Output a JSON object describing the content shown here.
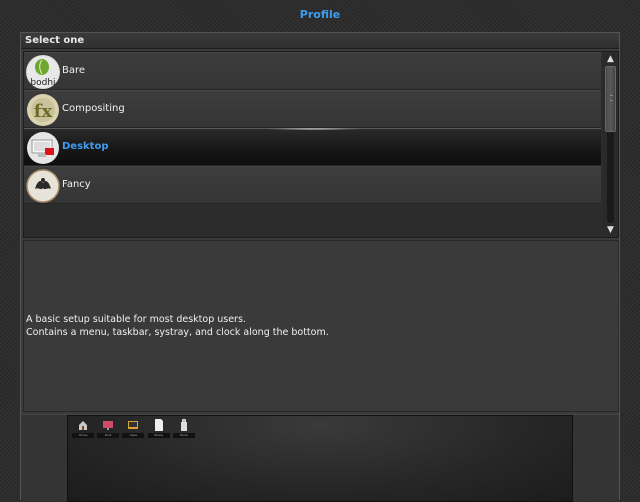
{
  "window": {
    "title": "Profile"
  },
  "section": {
    "header": "Select one"
  },
  "profiles": [
    {
      "label": "Bare",
      "icon": "bodhi-leaf-icon",
      "icon_text": "bodhi",
      "selected": false
    },
    {
      "label": "Compositing",
      "icon": "compositing-fx-icon",
      "icon_text": "fx",
      "selected": false
    },
    {
      "label": "Desktop",
      "icon": "desktop-icon",
      "selected": true
    },
    {
      "label": "Fancy",
      "icon": "fancy-ornament-icon",
      "selected": false
    }
  ],
  "description": {
    "line1": "A basic setup suitable for most desktop users.",
    "line2": "Contains a menu, taskbar, systray, and clock along the bottom."
  },
  "preview": {
    "shelf_icons": [
      {
        "icon": "home-icon",
        "caption": "Home"
      },
      {
        "icon": "monitor-icon",
        "caption": "Root"
      },
      {
        "icon": "terminal-icon",
        "caption": "Apps"
      },
      {
        "icon": "document-icon",
        "caption": "Share"
      },
      {
        "icon": "trash-icon",
        "caption": "Temp"
      }
    ]
  },
  "colors": {
    "accent": "#3e9cf0",
    "background": "#2e2e2e",
    "panel": "#3b3b3b"
  }
}
